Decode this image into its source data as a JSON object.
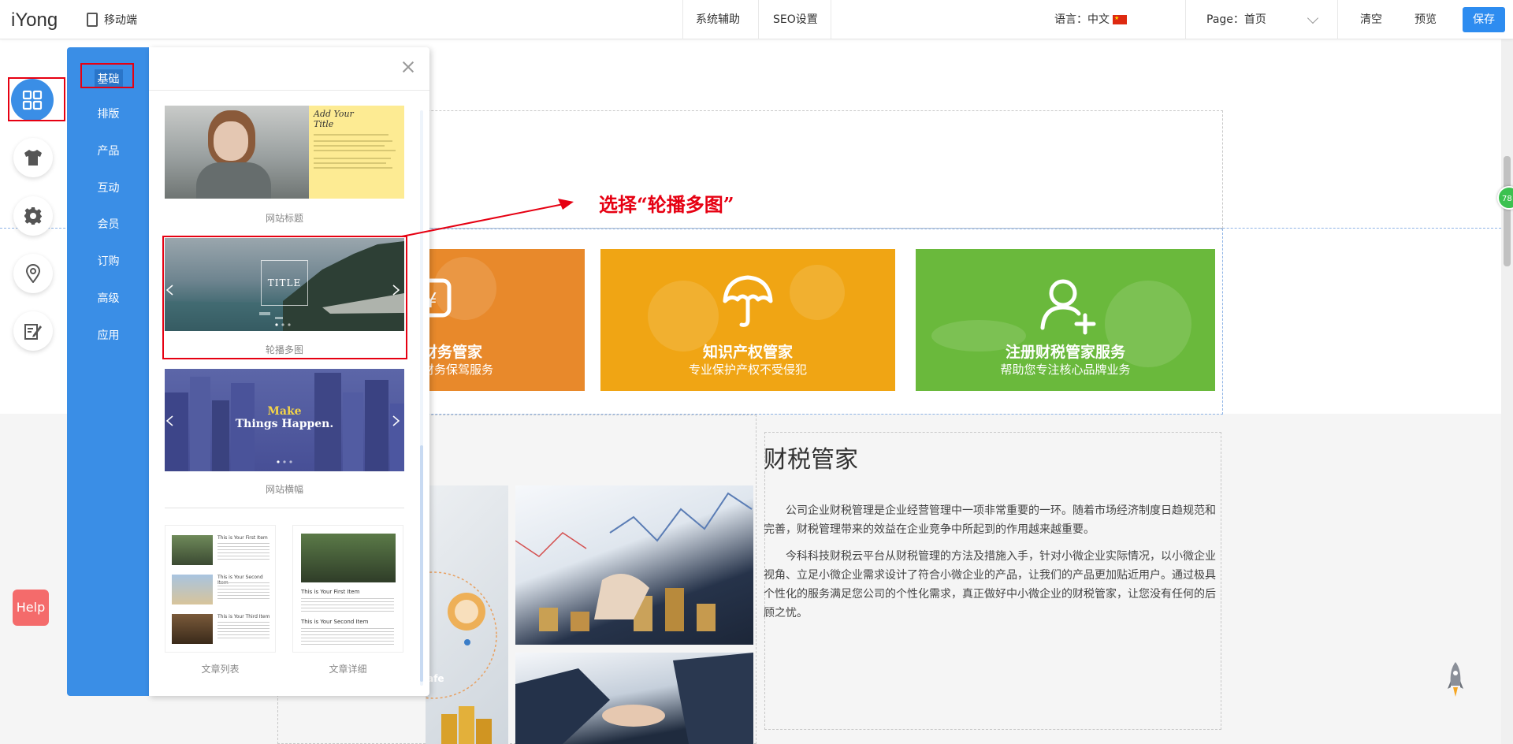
{
  "topbar": {
    "logo": "iYong",
    "mobile_label": "移动端",
    "system_assist": "系统辅助",
    "seo": "SEO设置",
    "language_label": "语言：中文",
    "page_label": "Page：首页",
    "clear": "清空",
    "preview": "预览",
    "save": "保存"
  },
  "panel": {
    "nav": [
      "基础",
      "排版",
      "产品",
      "互动",
      "会员",
      "订购",
      "高级",
      "应用"
    ],
    "items": {
      "website_title": "网站标题",
      "title_thumb_heading": "Add Your Title",
      "carousel": "轮播多图",
      "carousel_thumb_title": "TITLE",
      "banner": "网站横幅",
      "banner_thumb_line1": "Make",
      "banner_thumb_line2": "Things Happen.",
      "article_list": "文章列表",
      "article_detail": "文章详细",
      "list_thumb_items": [
        "This is Your First Item",
        "This is Your Second Item",
        "This is Your Third Item"
      ],
      "detail_thumb_items": [
        "This is Your First Item",
        "This is Your Second Item"
      ]
    }
  },
  "annotation": "选择“轮播多图”",
  "services": [
    {
      "title": "财务管家",
      "subtitle": "财务保驾服务",
      "color": "#e8892b"
    },
    {
      "title": "知识产权管家",
      "subtitle": "专业保护产权不受侵犯",
      "color": "#f0a514"
    },
    {
      "title": "注册财税管家服务",
      "subtitle": "帮助您专注核心品牌业务",
      "color": "#6ab93c"
    }
  ],
  "finance": {
    "title": "财税管家",
    "para1": "公司企业财税管理是企业经营管理中一项非常重要的一环。随着市场经济制度日趋规范和完善，财税管理带来的效益在企业竞争中所起到的作用越来越重要。",
    "para2": "今科科技财税云平台从财税管理的方法及措施入手，针对小微企业实际情况，以小微企业视角、立足小微企业需求设计了符合小微企业的产品，让我们的产品更加贴近用户。通过极具个性化的服务满足您公司的个性化需求，真正做好中小微企业的财税管家，让您没有任何的后顾之忧。"
  },
  "help": "Help",
  "badge": "78",
  "safe_label": "afe",
  "colors": {
    "accent": "#3a8ee6",
    "save": "#2d8cf0",
    "annotation": "#e60012",
    "help": "#f46b6b"
  }
}
